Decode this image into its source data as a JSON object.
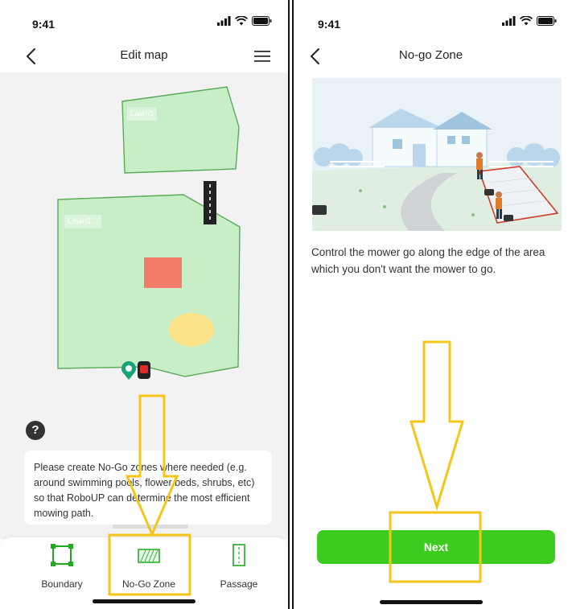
{
  "left_screen": {
    "status": {
      "time": "9:41"
    },
    "nav": {
      "title": "Edit map"
    },
    "map": {
      "zones": [
        {
          "label": "Lawn1"
        },
        {
          "label": "Lawn1..."
        }
      ]
    },
    "help": {
      "glyph": "?"
    },
    "tip": {
      "text": "Please create No-Go zones where needed (e.g. around swimming pools, flower beds, shrubs, etc) so that  RoboUP can determine the most efficient mowing path."
    },
    "tabs": [
      {
        "label": "Boundary",
        "icon": "boundary-icon"
      },
      {
        "label": "No-Go Zone",
        "icon": "no-go-zone-icon"
      },
      {
        "label": "Passage",
        "icon": "passage-icon"
      }
    ]
  },
  "right_screen": {
    "status": {
      "time": "9:41"
    },
    "nav": {
      "title": "No-go Zone"
    },
    "description": "Control the mower go along the edge of the area which you don't want the mower to go.",
    "next_label": "Next"
  },
  "colors": {
    "lawn_fill": "#c8eec8",
    "lawn_stroke": "#5aaa5a",
    "nogo_red": "#f47c6a",
    "nogo_yellow": "#fce38a",
    "accent_green": "#3ccc1f",
    "highlight_yellow": "#f5c518"
  }
}
